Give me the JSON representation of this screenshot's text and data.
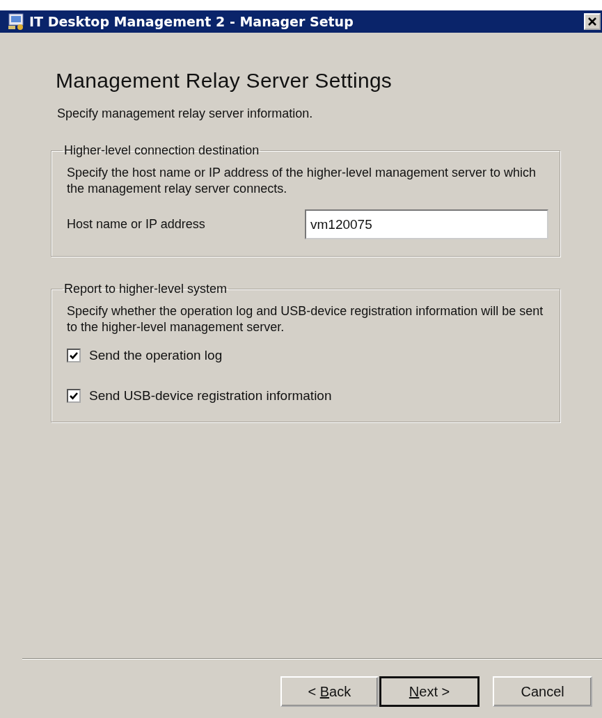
{
  "window": {
    "title": "IT Desktop Management 2 - Manager Setup"
  },
  "heading": "Management Relay Server Settings",
  "subtitle": "Specify management relay server information.",
  "groups": [
    {
      "kind": "field",
      "legend": "Higher-level connection destination",
      "description": "Specify the host name or IP address of the higher-level management server to which the management relay server connects.",
      "field": {
        "label": "Host name or IP address",
        "value": "vm120075"
      }
    },
    {
      "kind": "checks",
      "legend": "Report to higher-level system",
      "description": "Specify whether the operation log and USB-device registration information will be sent to the higher-level management server.",
      "checkboxes": [
        {
          "label": "Send the operation log",
          "checked": true
        },
        {
          "label": "Send USB-device registration information",
          "checked": true
        }
      ]
    }
  ],
  "buttons": [
    {
      "before": "< ",
      "mnemonic": "B",
      "after": "ack",
      "default": false
    },
    {
      "mnemonic": "N",
      "after": "ext >",
      "default": true
    },
    {
      "after": "Cancel",
      "default": false
    }
  ]
}
